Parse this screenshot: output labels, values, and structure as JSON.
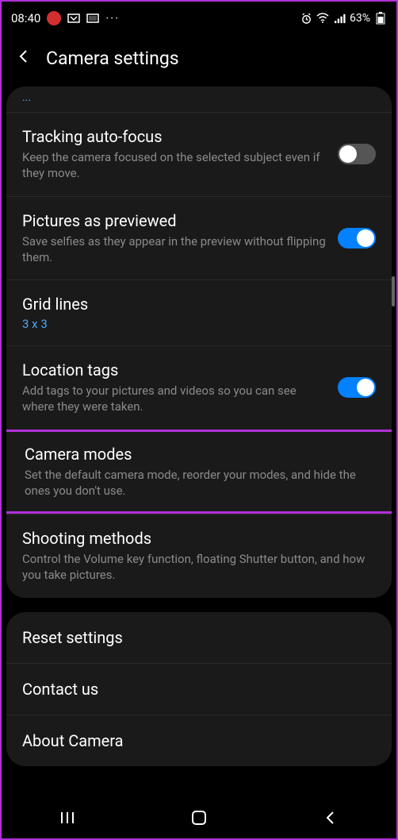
{
  "statusbar": {
    "time": "08:40",
    "battery": "63%"
  },
  "header": {
    "title": "Camera settings"
  },
  "settings": {
    "tracking_autofocus": {
      "title": "Tracking auto-focus",
      "desc": "Keep the camera focused on the selected subject even if they move.",
      "enabled": false
    },
    "pictures_previewed": {
      "title": "Pictures as previewed",
      "desc": "Save selfies as they appear in the preview without flipping them.",
      "enabled": true
    },
    "grid_lines": {
      "title": "Grid lines",
      "value": "3 x 3"
    },
    "location_tags": {
      "title": "Location tags",
      "desc": "Add tags to your pictures and videos so you can see where they were taken.",
      "enabled": true
    },
    "camera_modes": {
      "title": "Camera modes",
      "desc": "Set the default camera mode, reorder your modes, and hide the ones you don't use."
    },
    "shooting_methods": {
      "title": "Shooting methods",
      "desc": "Control the Volume key function, floating Shutter button, and how you take pictures."
    }
  },
  "footer": {
    "reset": "Reset settings",
    "contact": "Contact us",
    "about": "About Camera"
  }
}
